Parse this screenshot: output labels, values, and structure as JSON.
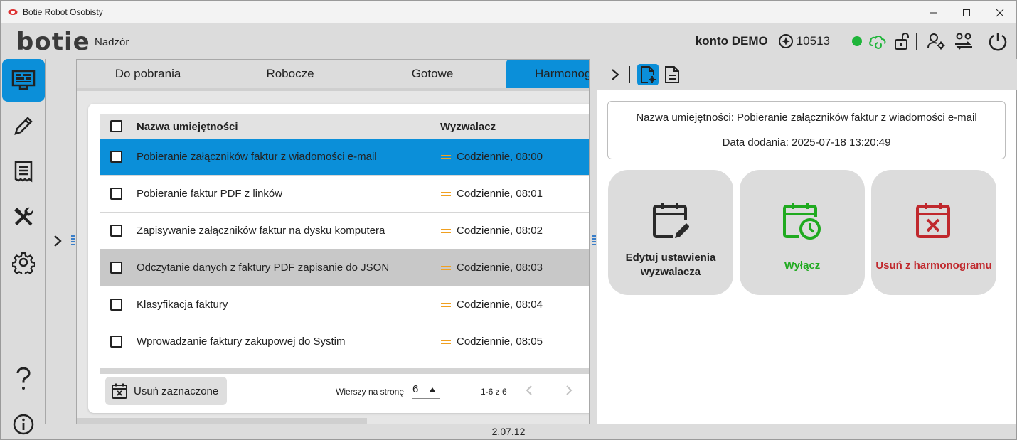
{
  "window": {
    "title": "Botie Robot Osobisty",
    "controls": [
      "minimize-icon",
      "maximize-icon",
      "close-icon"
    ]
  },
  "header": {
    "logo": "botie",
    "page_title": "Nadzór",
    "account": "konto DEMO",
    "credits": "10513",
    "status_color": "#1fb53a",
    "icons": [
      "credits-icon",
      "online-status-icon",
      "cloud-sync-icon",
      "unlock-icon",
      "user-settings-icon",
      "users-swap-icon",
      "power-icon"
    ]
  },
  "sidebar": {
    "items": [
      {
        "name": "monitor-icon",
        "active": true
      },
      {
        "name": "pencil-icon",
        "active": false
      },
      {
        "name": "receipt-icon",
        "active": false
      },
      {
        "name": "tools-icon",
        "active": false
      },
      {
        "name": "gear-icon",
        "active": false
      },
      {
        "name": "help-icon",
        "active": false
      },
      {
        "name": "info-icon",
        "active": false
      }
    ]
  },
  "tabs": [
    {
      "label": "Do pobrania",
      "active": false
    },
    {
      "label": "Robocze",
      "active": false
    },
    {
      "label": "Gotowe",
      "active": false
    },
    {
      "label": "Harmonogram",
      "active": true
    }
  ],
  "table": {
    "columns": {
      "name": "Nazwa umiejętności",
      "trigger": "Wyzwalacz"
    },
    "rows": [
      {
        "name": "Pobieranie załączników faktur z wiadomości e-mail",
        "trigger": "Codziennie, 08:00",
        "state": "selected"
      },
      {
        "name": "Pobieranie faktur PDF z linków",
        "trigger": "Codziennie, 08:01",
        "state": "normal"
      },
      {
        "name": "Zapisywanie załączników faktur na dysku komputera",
        "trigger": "Codziennie, 08:02",
        "state": "normal"
      },
      {
        "name": "Odczytanie danych z faktury PDF zapisanie do JSON",
        "trigger": "Codziennie, 08:03",
        "state": "hover"
      },
      {
        "name": "Klasyfikacja faktury",
        "trigger": "Codziennie, 08:04",
        "state": "normal"
      },
      {
        "name": "Wprowadzanie faktury zakupowej do Systim",
        "trigger": "Codziennie, 08:05",
        "state": "normal"
      }
    ]
  },
  "footer": {
    "delete_selected": "Usuń zaznaczone",
    "rows_per_page_label": "Wierszy na stronę",
    "rows_per_page": "6",
    "range": "1-6 z 6"
  },
  "details": {
    "skill_name_line": "Nazwa umiejętności: Pobieranie załączników faktur z wiadomości e-mail",
    "date_added_line": "Data dodania: 2025-07-18 13:20:49",
    "actions": {
      "edit": "Edytuj ustawienia wyzwalacza",
      "disable": "Wyłącz",
      "remove": "Usuń z harmonogramu"
    }
  },
  "colors": {
    "accent": "#0b8fd9",
    "trigger_icon": "#f0a020",
    "disable": "#1faa1f",
    "remove": "#c0282d"
  },
  "version": "2.07.12"
}
